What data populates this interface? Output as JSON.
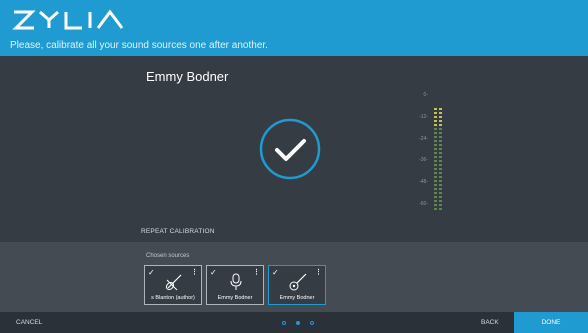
{
  "header": {
    "logo_text": "ZYLIA",
    "subtitle": "Please, calibrate all your sound sources one after another."
  },
  "main": {
    "source_name": "Emmy Bodner",
    "repeat_label": "REPEAT CALIBRATION",
    "meter_ticks": [
      "0-",
      "-12-",
      "-24-",
      "-36-",
      "-48-",
      "-60-"
    ]
  },
  "sources": {
    "label": "Chosen sources",
    "cards": [
      {
        "label": "s Blanton (author)",
        "icon": "guitar-icon"
      },
      {
        "label": "Emmy Bodner",
        "icon": "microphone-icon"
      },
      {
        "label": "Emmy Bodner",
        "icon": "acoustic-guitar-icon"
      }
    ],
    "check_glyph": "✓",
    "menu_glyph": "⋮"
  },
  "footer": {
    "cancel_label": "CANCEL",
    "back_label": "BACK",
    "done_label": "DONE",
    "page_count": 3,
    "current_page": 2
  },
  "colors": {
    "accent": "#1f9bd1",
    "meter_yellow": "#c9c24a",
    "meter_green": "#5d8a4a"
  }
}
